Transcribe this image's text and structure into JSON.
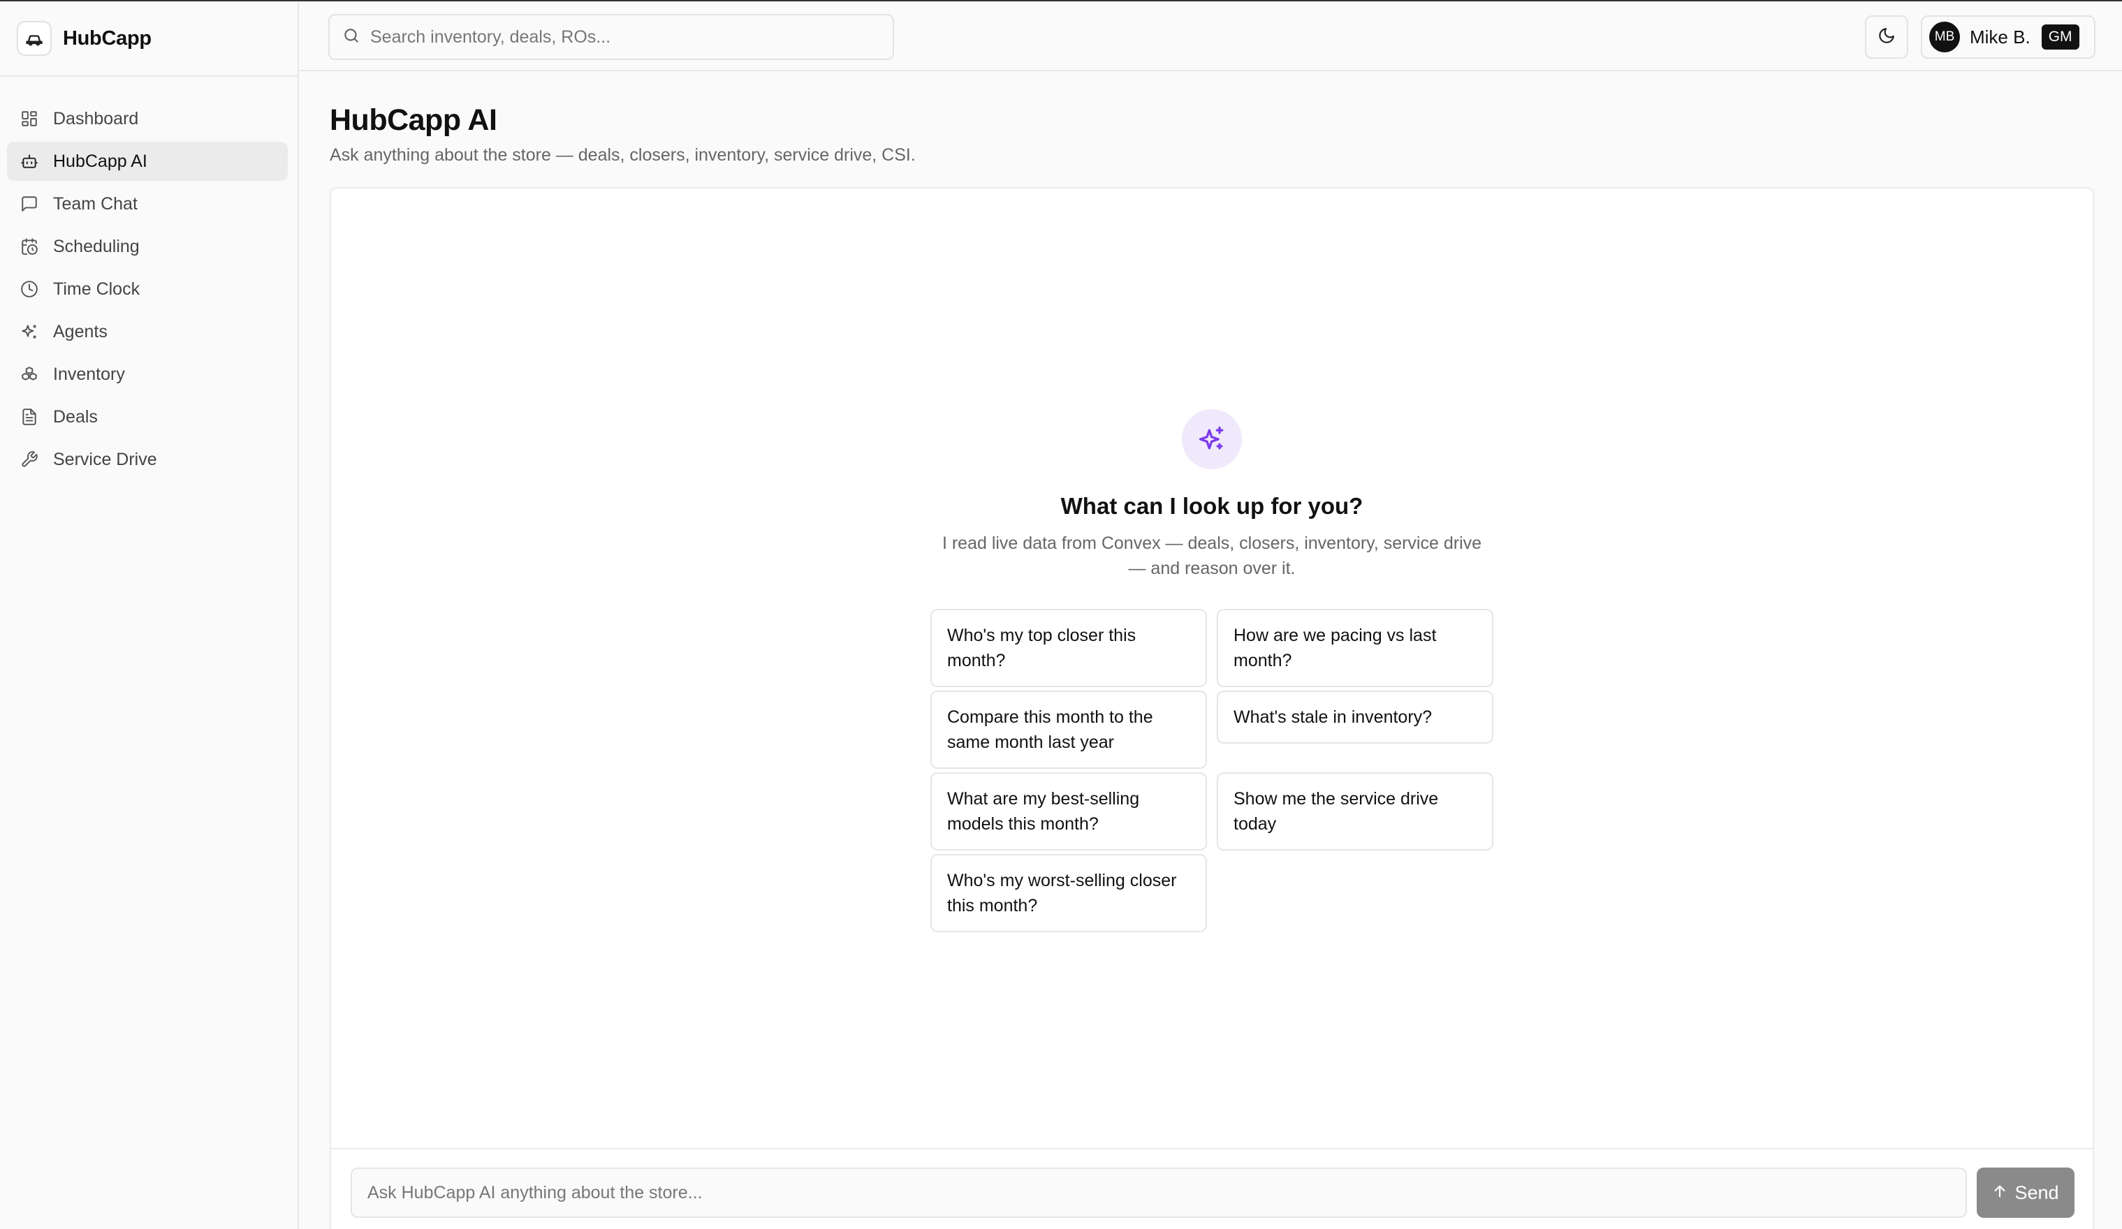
{
  "app": {
    "name": "HubCapp"
  },
  "sidebar": {
    "items": [
      {
        "label": "Dashboard",
        "icon": "dashboard-grid-icon",
        "active": false
      },
      {
        "label": "HubCapp AI",
        "icon": "bot-icon",
        "active": true
      },
      {
        "label": "Team Chat",
        "icon": "message-square-icon",
        "active": false
      },
      {
        "label": "Scheduling",
        "icon": "calendar-clock-icon",
        "active": false
      },
      {
        "label": "Time Clock",
        "icon": "clock-icon",
        "active": false
      },
      {
        "label": "Agents",
        "icon": "sparkles-icon",
        "active": false
      },
      {
        "label": "Inventory",
        "icon": "boxes-icon",
        "active": false
      },
      {
        "label": "Deals",
        "icon": "file-text-icon",
        "active": false
      },
      {
        "label": "Service Drive",
        "icon": "wrench-icon",
        "active": false
      }
    ]
  },
  "header": {
    "search_placeholder": "Search inventory, deals, ROs...",
    "user": {
      "initials": "MB",
      "name": "Mike B.",
      "role": "GM"
    }
  },
  "page": {
    "title": "HubCapp AI",
    "subtitle": "Ask anything about the store — deals, closers, inventory, service drive, CSI."
  },
  "chat": {
    "empty_title": "What can I look up for you?",
    "empty_description": "I read live data from Convex — deals, closers, inventory, service drive — and reason over it.",
    "suggestions": [
      "Who's my top closer this month?",
      "How are we pacing vs last month?",
      "Compare this month to the same month last year",
      "What's stale in inventory?",
      "What are my best-selling models this month?",
      "Show me the service drive today",
      "Who's my worst-selling closer this month?"
    ],
    "input_placeholder": "Ask HubCapp AI anything about the store...",
    "send_label": "Send"
  },
  "colors": {
    "accent": "#7c3aed",
    "accent_bg": "#efe9fb",
    "send_disabled": "#8a8a8a"
  }
}
